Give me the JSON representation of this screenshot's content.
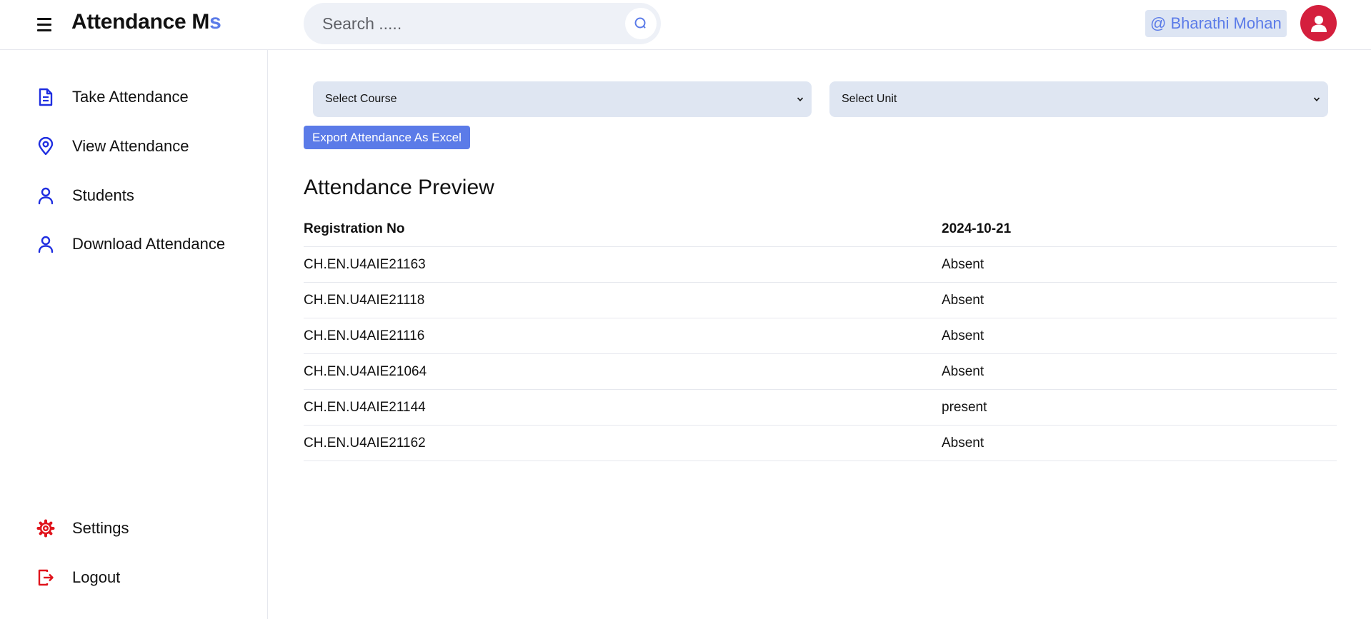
{
  "header": {
    "brand_main": "Attendance M",
    "brand_accent": "s",
    "search_placeholder": "Search .....",
    "user_label": "@ Bharathi Mohan"
  },
  "sidebar": {
    "items": [
      {
        "label": "Take Attendance",
        "icon": "document-icon"
      },
      {
        "label": "View Attendance",
        "icon": "location-pin-icon"
      },
      {
        "label": "Students",
        "icon": "user-icon"
      },
      {
        "label": "Download Attendance",
        "icon": "user-icon"
      }
    ],
    "bottom_items": [
      {
        "label": "Settings",
        "icon": "gear-icon"
      },
      {
        "label": "Logout",
        "icon": "logout-icon"
      }
    ]
  },
  "main": {
    "course_select": "Select Course",
    "unit_select": "Select Unit",
    "export_label": "Export Attendance As Excel",
    "section_title": "Attendance Preview",
    "table": {
      "headers": [
        "Registration No",
        "2024-10-21"
      ],
      "rows": [
        [
          "CH.EN.U4AIE21163",
          "Absent"
        ],
        [
          "CH.EN.U4AIE21118",
          "Absent"
        ],
        [
          "CH.EN.U4AIE21116",
          "Absent"
        ],
        [
          "CH.EN.U4AIE21064",
          "Absent"
        ],
        [
          "CH.EN.U4AIE21144",
          "present"
        ],
        [
          "CH.EN.U4AIE21162",
          "Absent"
        ]
      ]
    }
  },
  "colors": {
    "accent": "#5b7be8",
    "nav_icon": "#1f2ee0",
    "danger_icon": "#e0141c",
    "avatar": "#d41f3d",
    "select_bg": "#dfe6f2"
  }
}
